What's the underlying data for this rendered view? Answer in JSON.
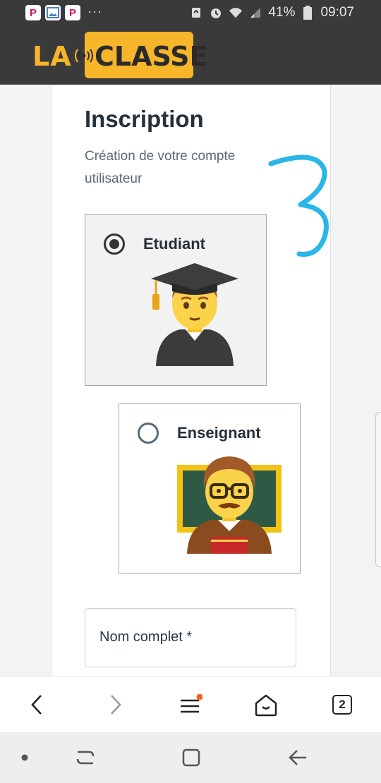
{
  "status_bar": {
    "app_icons": [
      "P",
      "image",
      "P"
    ],
    "more": "···",
    "battery": "41%",
    "time": "09:07"
  },
  "brand": {
    "part1": "LA",
    "part2": "CLASSE"
  },
  "page": {
    "title": "Inscription",
    "subtitle": "Création de votre compte utilisateur"
  },
  "roles": [
    {
      "label": "Etudiant",
      "selected": true,
      "emoji": "👨‍🎓"
    },
    {
      "label": "Enseignant",
      "selected": false,
      "emoji": "👨‍🏫"
    }
  ],
  "form": {
    "fullname_label": "Nom complet *"
  },
  "browser_bar": {
    "tabs_count": "2",
    "icons": [
      "back-icon",
      "forward-icon",
      "menu-icon",
      "home-icon",
      "tabs-icon"
    ]
  },
  "nav_bar": {
    "icons": [
      "dot-icon",
      "recent-apps-icon",
      "home-icon",
      "back-icon"
    ]
  },
  "colors": {
    "brand_yellow": "#f7b52a",
    "header_dark": "#3a3a3a",
    "annotation_blue": "#29b6e8",
    "badge_orange": "#f26522"
  }
}
